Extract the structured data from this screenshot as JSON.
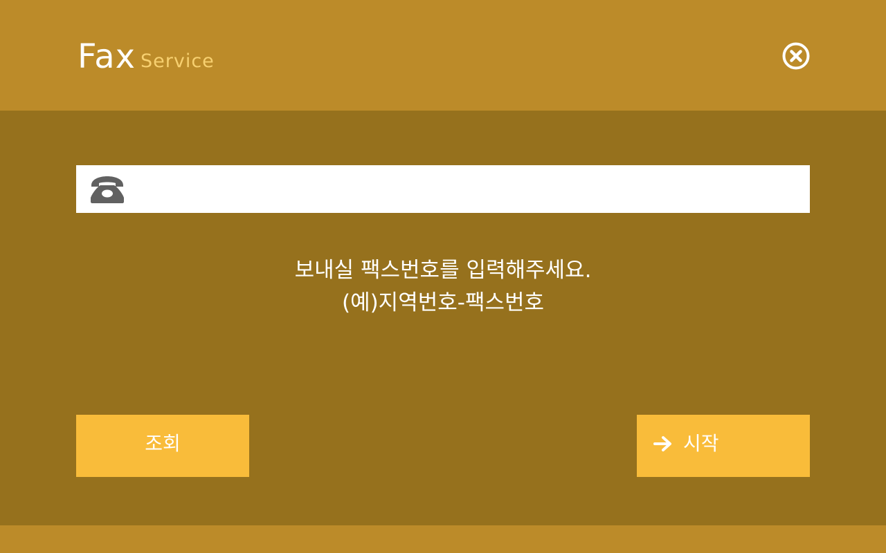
{
  "header": {
    "title": "Fax",
    "subtitle": "Service",
    "close_icon": "close-circle-icon"
  },
  "fax_input": {
    "value": "",
    "placeholder": "",
    "icon": "telephone-icon"
  },
  "instructions": {
    "line1": "보내실 팩스번호를 입력해주세요.",
    "line2": "(예)지역번호-팩스번호"
  },
  "buttons": {
    "inquiry_label": "조회",
    "start_label": "시작",
    "start_icon": "arrow-right-icon"
  },
  "colors": {
    "header_bg": "#bc8b29",
    "body_bg": "#96711d",
    "button_bg": "#f9bc3a",
    "subtitle": "#f7d070",
    "icon_gray": "#616161"
  }
}
